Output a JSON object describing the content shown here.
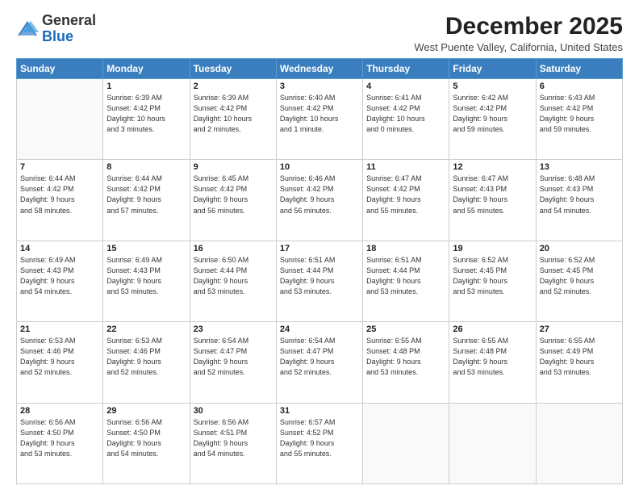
{
  "header": {
    "logo_general": "General",
    "logo_blue": "Blue",
    "month": "December 2025",
    "location": "West Puente Valley, California, United States"
  },
  "weekdays": [
    "Sunday",
    "Monday",
    "Tuesday",
    "Wednesday",
    "Thursday",
    "Friday",
    "Saturday"
  ],
  "weeks": [
    [
      {
        "day": "",
        "info": ""
      },
      {
        "day": "1",
        "info": "Sunrise: 6:39 AM\nSunset: 4:42 PM\nDaylight: 10 hours\nand 3 minutes."
      },
      {
        "day": "2",
        "info": "Sunrise: 6:39 AM\nSunset: 4:42 PM\nDaylight: 10 hours\nand 2 minutes."
      },
      {
        "day": "3",
        "info": "Sunrise: 6:40 AM\nSunset: 4:42 PM\nDaylight: 10 hours\nand 1 minute."
      },
      {
        "day": "4",
        "info": "Sunrise: 6:41 AM\nSunset: 4:42 PM\nDaylight: 10 hours\nand 0 minutes."
      },
      {
        "day": "5",
        "info": "Sunrise: 6:42 AM\nSunset: 4:42 PM\nDaylight: 9 hours\nand 59 minutes."
      },
      {
        "day": "6",
        "info": "Sunrise: 6:43 AM\nSunset: 4:42 PM\nDaylight: 9 hours\nand 59 minutes."
      }
    ],
    [
      {
        "day": "7",
        "info": "Sunrise: 6:44 AM\nSunset: 4:42 PM\nDaylight: 9 hours\nand 58 minutes."
      },
      {
        "day": "8",
        "info": "Sunrise: 6:44 AM\nSunset: 4:42 PM\nDaylight: 9 hours\nand 57 minutes."
      },
      {
        "day": "9",
        "info": "Sunrise: 6:45 AM\nSunset: 4:42 PM\nDaylight: 9 hours\nand 56 minutes."
      },
      {
        "day": "10",
        "info": "Sunrise: 6:46 AM\nSunset: 4:42 PM\nDaylight: 9 hours\nand 56 minutes."
      },
      {
        "day": "11",
        "info": "Sunrise: 6:47 AM\nSunset: 4:42 PM\nDaylight: 9 hours\nand 55 minutes."
      },
      {
        "day": "12",
        "info": "Sunrise: 6:47 AM\nSunset: 4:43 PM\nDaylight: 9 hours\nand 55 minutes."
      },
      {
        "day": "13",
        "info": "Sunrise: 6:48 AM\nSunset: 4:43 PM\nDaylight: 9 hours\nand 54 minutes."
      }
    ],
    [
      {
        "day": "14",
        "info": "Sunrise: 6:49 AM\nSunset: 4:43 PM\nDaylight: 9 hours\nand 54 minutes."
      },
      {
        "day": "15",
        "info": "Sunrise: 6:49 AM\nSunset: 4:43 PM\nDaylight: 9 hours\nand 53 minutes."
      },
      {
        "day": "16",
        "info": "Sunrise: 6:50 AM\nSunset: 4:44 PM\nDaylight: 9 hours\nand 53 minutes."
      },
      {
        "day": "17",
        "info": "Sunrise: 6:51 AM\nSunset: 4:44 PM\nDaylight: 9 hours\nand 53 minutes."
      },
      {
        "day": "18",
        "info": "Sunrise: 6:51 AM\nSunset: 4:44 PM\nDaylight: 9 hours\nand 53 minutes."
      },
      {
        "day": "19",
        "info": "Sunrise: 6:52 AM\nSunset: 4:45 PM\nDaylight: 9 hours\nand 53 minutes."
      },
      {
        "day": "20",
        "info": "Sunrise: 6:52 AM\nSunset: 4:45 PM\nDaylight: 9 hours\nand 52 minutes."
      }
    ],
    [
      {
        "day": "21",
        "info": "Sunrise: 6:53 AM\nSunset: 4:46 PM\nDaylight: 9 hours\nand 52 minutes."
      },
      {
        "day": "22",
        "info": "Sunrise: 6:53 AM\nSunset: 4:46 PM\nDaylight: 9 hours\nand 52 minutes."
      },
      {
        "day": "23",
        "info": "Sunrise: 6:54 AM\nSunset: 4:47 PM\nDaylight: 9 hours\nand 52 minutes."
      },
      {
        "day": "24",
        "info": "Sunrise: 6:54 AM\nSunset: 4:47 PM\nDaylight: 9 hours\nand 52 minutes."
      },
      {
        "day": "25",
        "info": "Sunrise: 6:55 AM\nSunset: 4:48 PM\nDaylight: 9 hours\nand 53 minutes."
      },
      {
        "day": "26",
        "info": "Sunrise: 6:55 AM\nSunset: 4:48 PM\nDaylight: 9 hours\nand 53 minutes."
      },
      {
        "day": "27",
        "info": "Sunrise: 6:55 AM\nSunset: 4:49 PM\nDaylight: 9 hours\nand 53 minutes."
      }
    ],
    [
      {
        "day": "28",
        "info": "Sunrise: 6:56 AM\nSunset: 4:50 PM\nDaylight: 9 hours\nand 53 minutes."
      },
      {
        "day": "29",
        "info": "Sunrise: 6:56 AM\nSunset: 4:50 PM\nDaylight: 9 hours\nand 54 minutes."
      },
      {
        "day": "30",
        "info": "Sunrise: 6:56 AM\nSunset: 4:51 PM\nDaylight: 9 hours\nand 54 minutes."
      },
      {
        "day": "31",
        "info": "Sunrise: 6:57 AM\nSunset: 4:52 PM\nDaylight: 9 hours\nand 55 minutes."
      },
      {
        "day": "",
        "info": ""
      },
      {
        "day": "",
        "info": ""
      },
      {
        "day": "",
        "info": ""
      }
    ]
  ]
}
